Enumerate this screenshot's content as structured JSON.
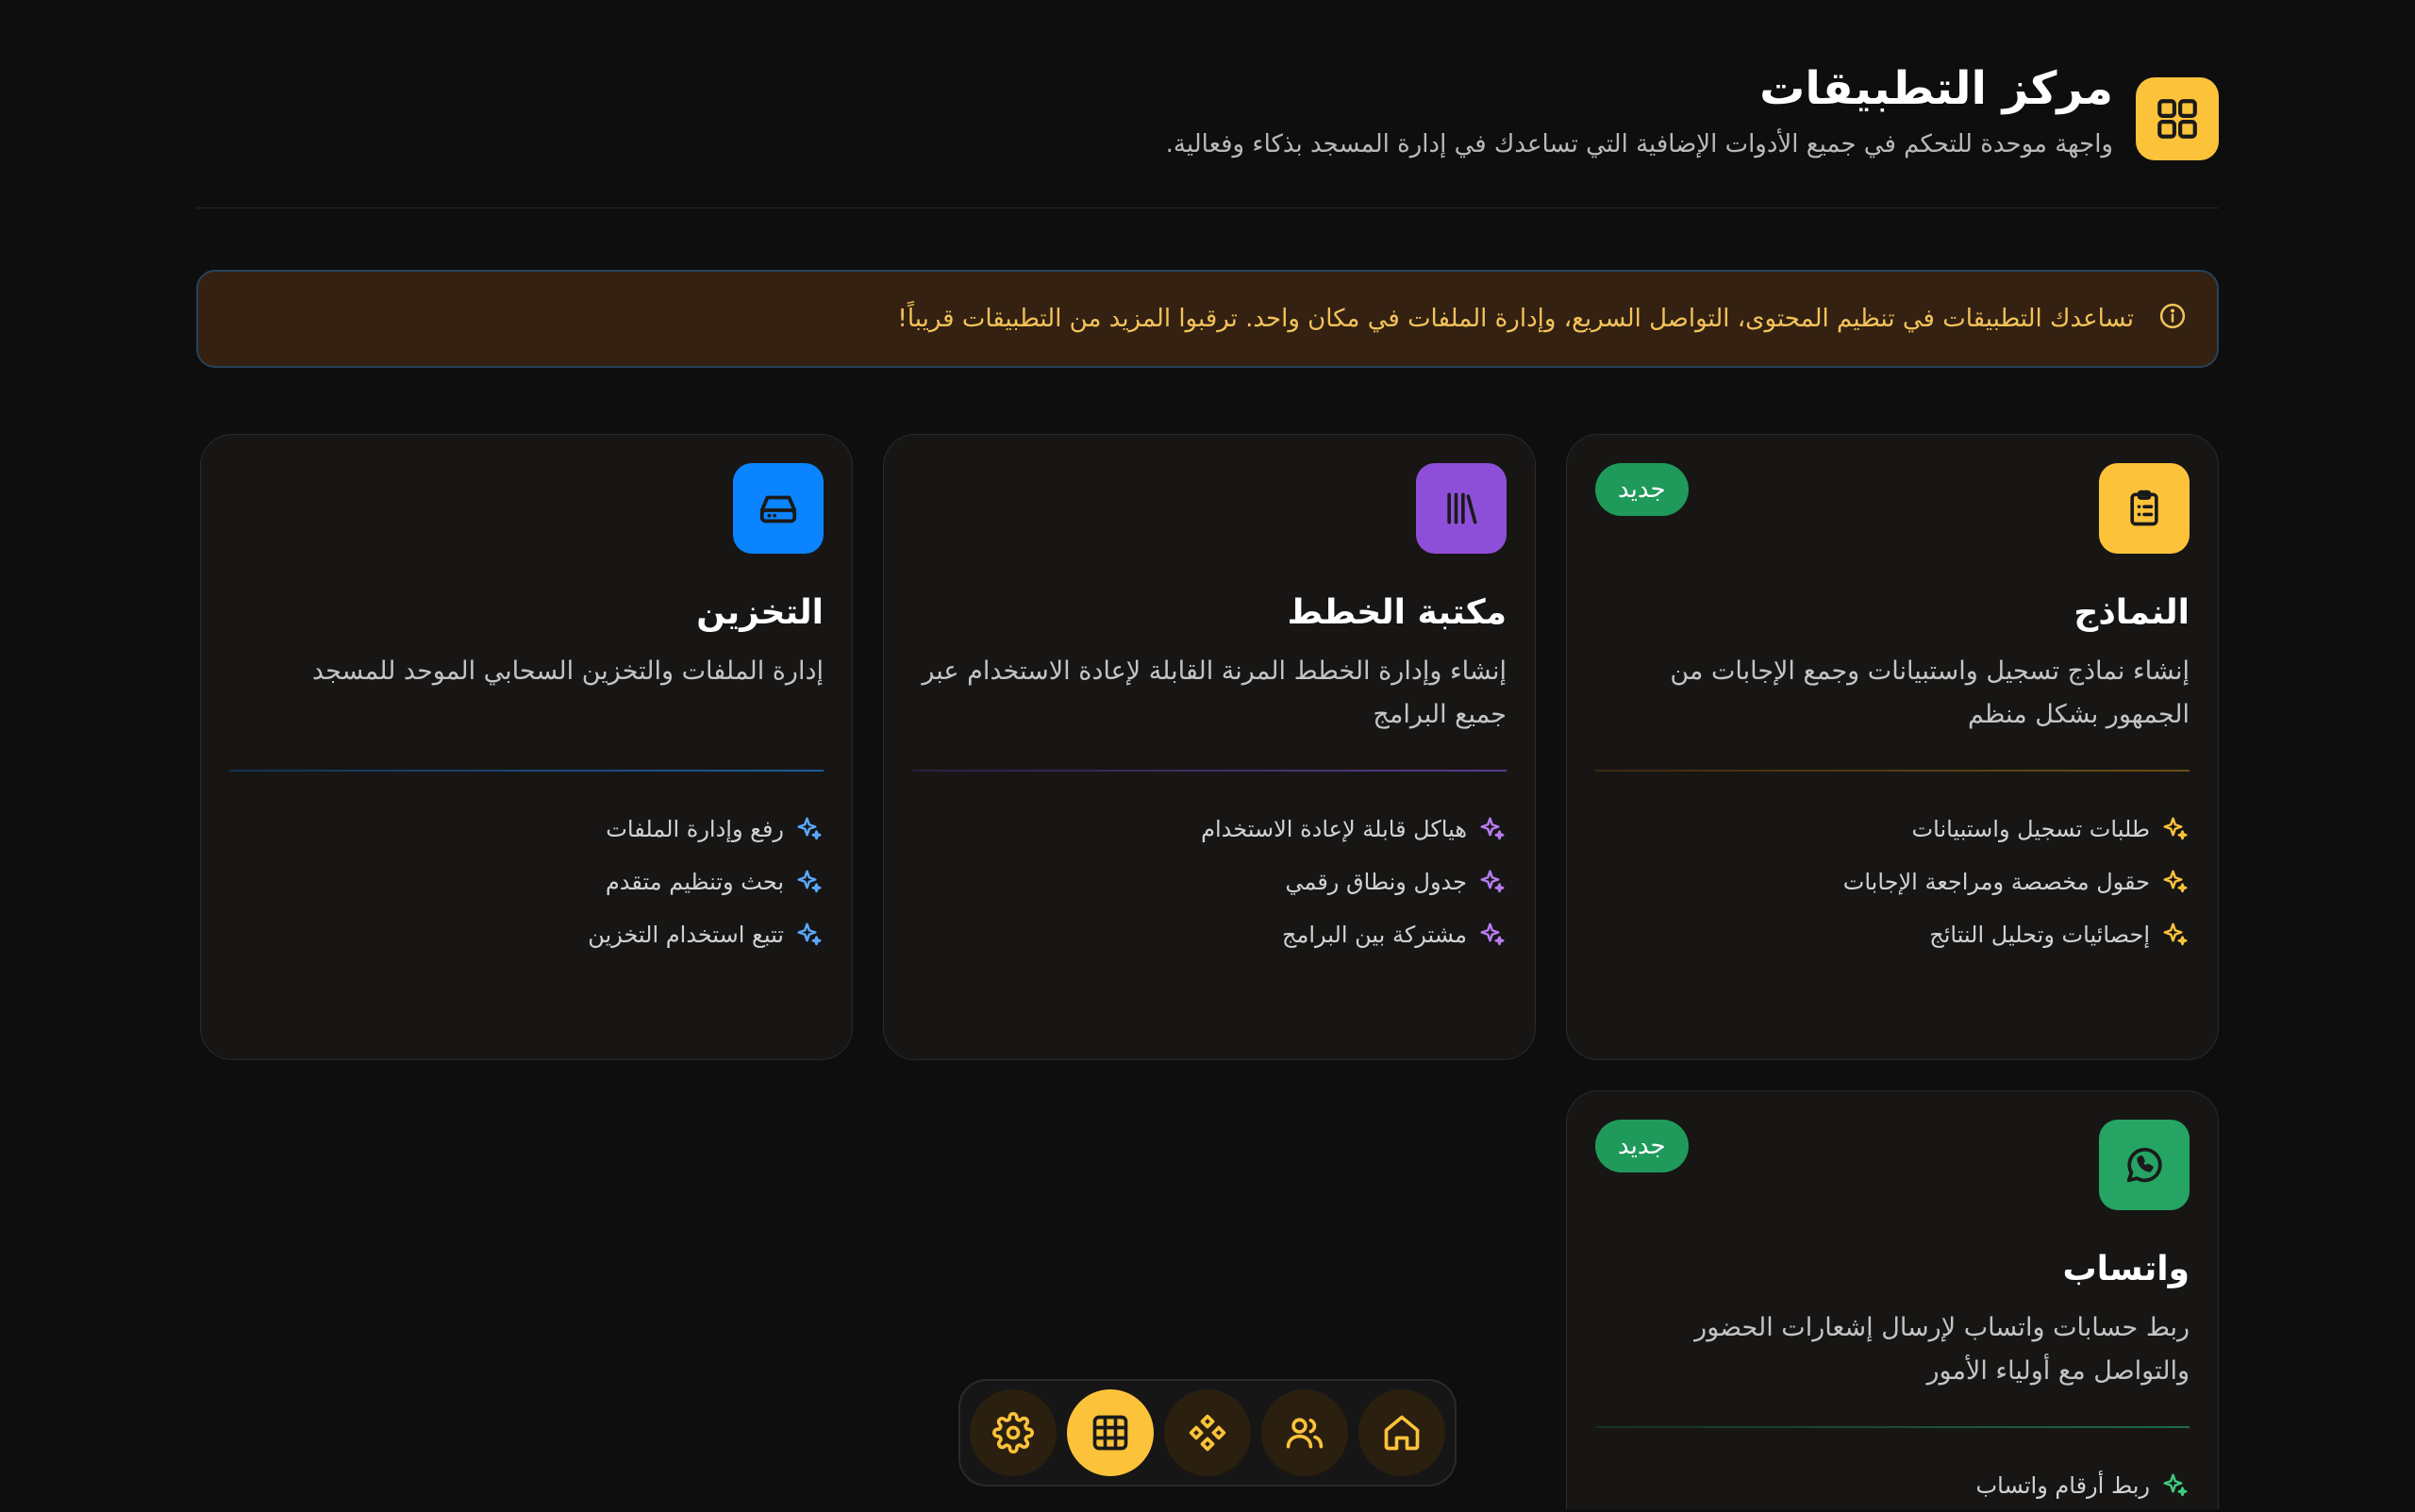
{
  "header": {
    "title": "مركز التطبيقات",
    "subtitle": "واجهة موحدة للتحكم في جميع الأدوات الإضافية التي تساعدك في إدارة المسجد بذكاء وفعالية."
  },
  "banner": {
    "text": "تساعدك التطبيقات في تنظيم المحتوى، التواصل السريع، وإدارة الملفات في مكان واحد. ترقبوا المزيد من التطبيقات قريباً!"
  },
  "cards": [
    {
      "title": "النماذج",
      "description": "إنشاء نماذج تسجيل واستبيانات وجمع الإجابات من الجمهور بشكل منظم",
      "badge": "جديد",
      "icon": "clipboard-icon",
      "accent": "#fcc33a",
      "features": [
        "طلبات تسجيل واستبيانات",
        "حقول مخصصة ومراجعة الإجابات",
        "إحصائيات وتحليل النتائج"
      ]
    },
    {
      "title": "مكتبة الخطط",
      "description": "إنشاء وإدارة الخطط المرنة القابلة لإعادة الاستخدام عبر جميع البرامج",
      "icon": "library-icon",
      "accent": "#8e4fd8",
      "features": [
        "هياكل قابلة لإعادة الاستخدام",
        "جدول ونطاق رقمي",
        "مشتركة بين البرامج"
      ]
    },
    {
      "title": "التخزين",
      "description": "إدارة الملفات والتخزين السحابي الموحد للمسجد",
      "icon": "hard-drive-icon",
      "accent": "#0a84ff",
      "features": [
        "رفع وإدارة الملفات",
        "بحث وتنظيم متقدم",
        "تتبع استخدام التخزين"
      ]
    },
    {
      "title": "واتساب",
      "description": "ربط حسابات واتساب لإرسال إشعارات الحضور والتواصل مع أولياء الأمور",
      "badge": "جديد",
      "icon": "whatsapp-icon",
      "accent": "#25a464",
      "features": [
        "ربط أرقام واتساب"
      ]
    }
  ],
  "dock": {
    "items": [
      "home-icon",
      "users-icon",
      "components-icon",
      "apps-grid-icon",
      "settings-icon"
    ],
    "active": "apps-grid-icon",
    "accent": "#fcc33a"
  }
}
